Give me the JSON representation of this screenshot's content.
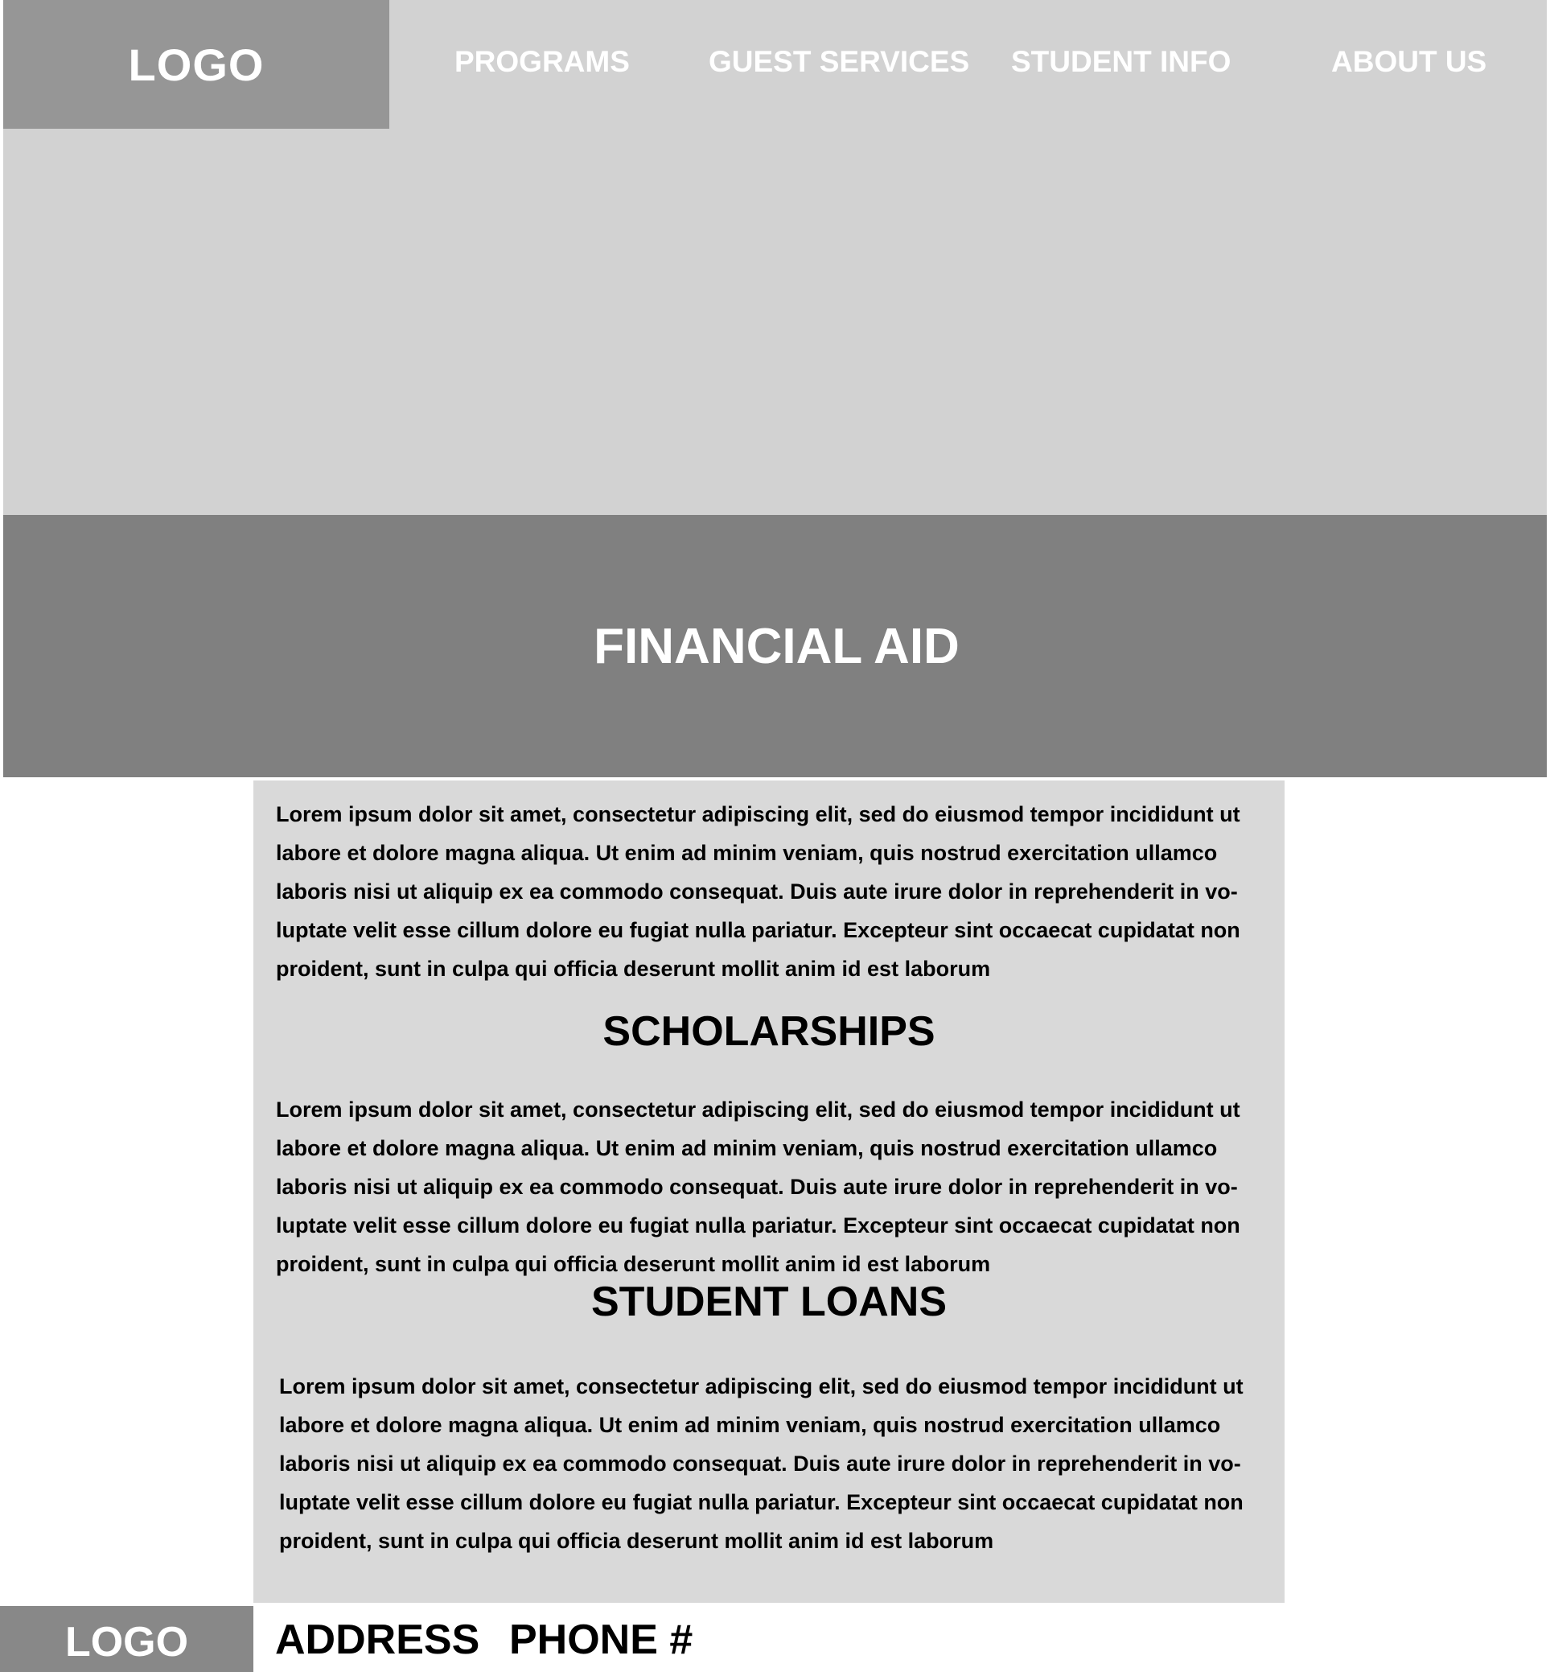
{
  "header": {
    "logo": "LOGO",
    "nav": [
      "PROGRAMS",
      "GUEST SERVICES",
      "STUDENT INFO",
      "ABOUT US"
    ]
  },
  "page_title": "FINANCIAL AID",
  "sections": [
    {
      "heading": "",
      "lines": [
        "Lorem ipsum dolor sit amet, consectetur adipiscing elit, sed do eiusmod tempor incididunt ut",
        "labore et dolore magna aliqua. Ut enim ad minim veniam, quis nostrud exercitation ullamco",
        "laboris nisi ut aliquip ex ea commodo consequat. Duis aute irure dolor in reprehenderit in vo-",
        "luptate velit esse cillum dolore eu fugiat nulla pariatur. Excepteur sint occaecat cupidatat non",
        "proident, sunt in culpa qui officia deserunt mollit anim id est laborum"
      ]
    },
    {
      "heading": "SCHOLARSHIPS",
      "lines": [
        "Lorem ipsum dolor sit amet, consectetur adipiscing elit, sed do eiusmod tempor incididunt ut",
        "labore et dolore magna aliqua. Ut enim ad minim veniam, quis nostrud exercitation ullamco",
        "laboris nisi ut aliquip ex ea commodo consequat. Duis aute irure dolor in reprehenderit in vo-",
        "luptate velit esse cillum dolore eu fugiat nulla pariatur. Excepteur sint occaecat cupidatat non",
        "proident, sunt in culpa qui officia deserunt mollit anim id est laborum"
      ]
    },
    {
      "heading": "STUDENT LOANS",
      "lines": [
        "Lorem ipsum dolor sit amet, consectetur adipiscing elit, sed do eiusmod tempor incididunt ut",
        "labore et dolore magna aliqua. Ut enim ad minim veniam, quis nostrud exercitation ullamco",
        "laboris nisi ut aliquip ex ea commodo consequat. Duis aute irure dolor in reprehenderit in vo-",
        "luptate velit esse cillum dolore eu fugiat nulla pariatur. Excepteur sint occaecat cupidatat non",
        "proident, sunt in culpa qui officia deserunt mollit anim id est laborum"
      ]
    }
  ],
  "footer": {
    "logo": "LOGO",
    "address": "ADDRESS",
    "phone": "PHONE #"
  },
  "colors": {
    "hero_bg": "#d2d2d2",
    "logo_bg": "#969696",
    "title_banner_bg": "#808080",
    "content_bg": "#d9d9d9",
    "footer_logo_bg": "#888888"
  }
}
